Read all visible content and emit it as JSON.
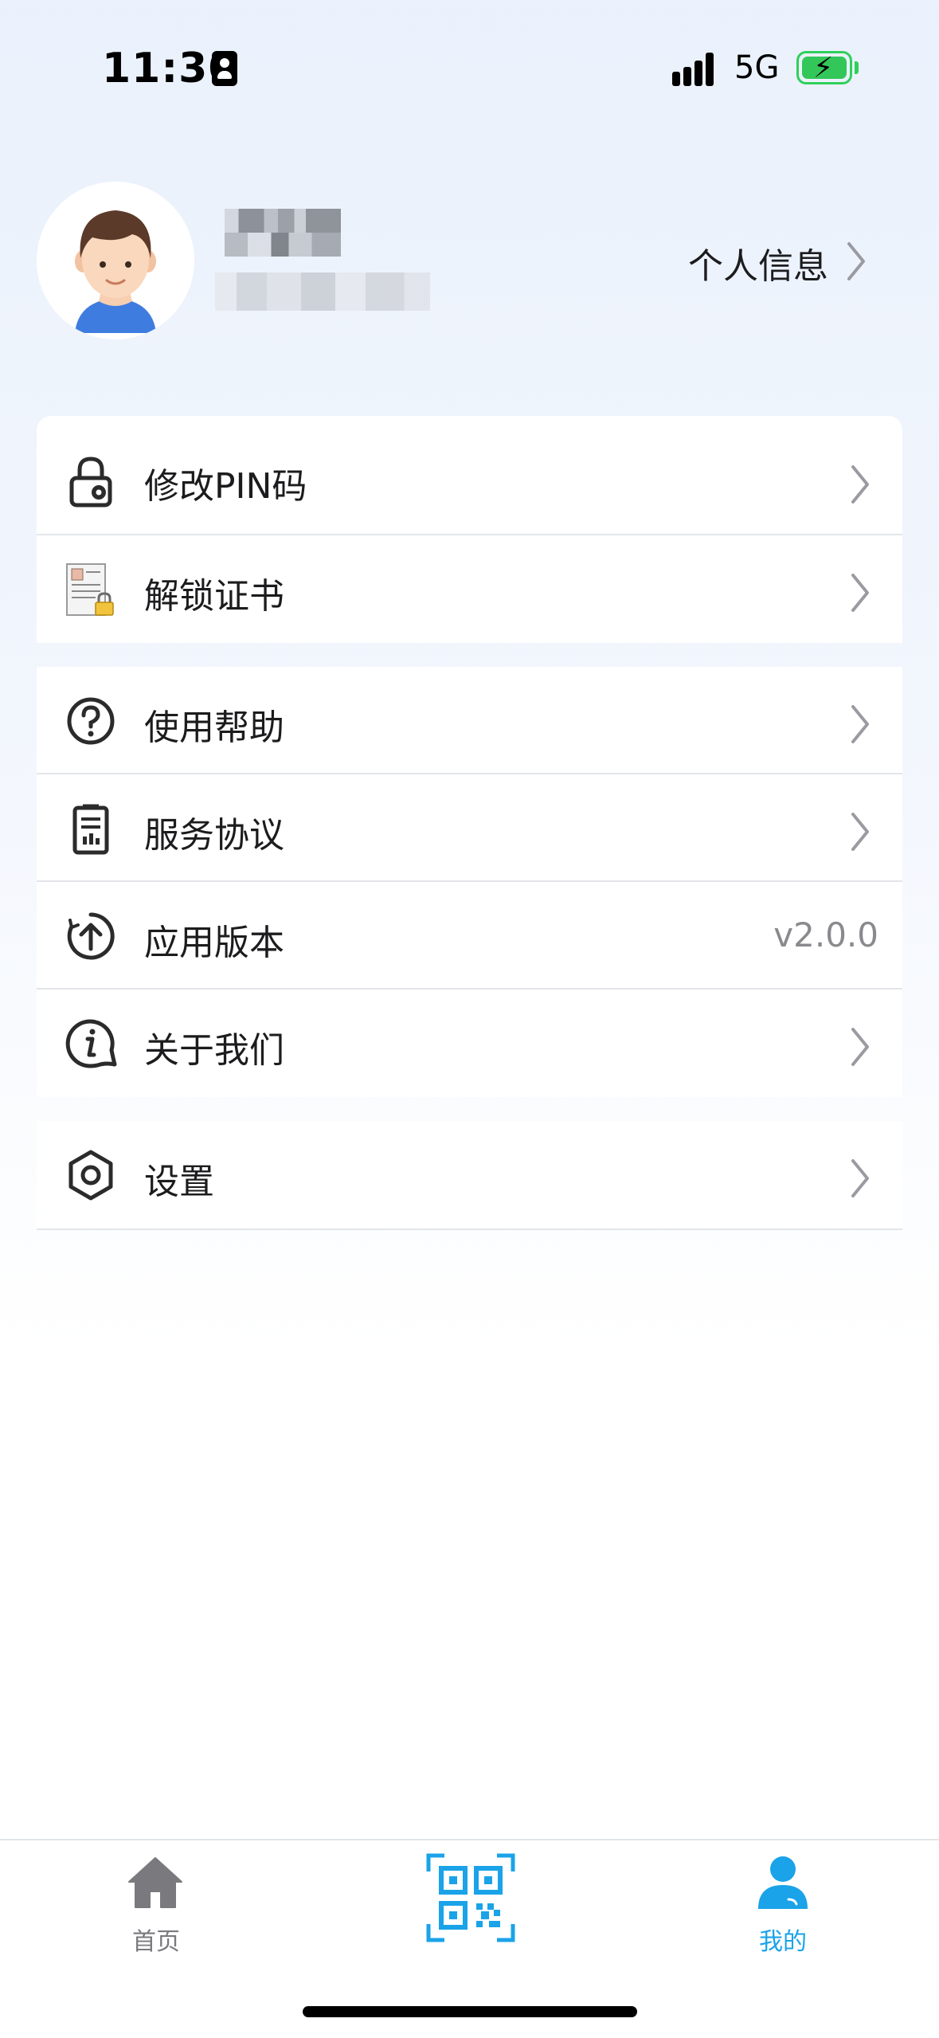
{
  "status_bar": {
    "time": "11:30",
    "network": "5G"
  },
  "profile": {
    "info_link": "个人信息"
  },
  "menu_groups": [
    [
      {
        "label": "修改PIN码",
        "icon": "lock-gear-icon"
      },
      {
        "label": "解锁证书",
        "icon": "certificate-lock-icon"
      }
    ],
    [
      {
        "label": "使用帮助",
        "icon": "question-circle-icon"
      },
      {
        "label": "服务协议",
        "icon": "clipboard-document-icon"
      },
      {
        "label": "应用版本",
        "icon": "upload-circle-icon",
        "value": "v2.0.0"
      },
      {
        "label": "关于我们",
        "icon": "info-bubble-icon"
      }
    ],
    [
      {
        "label": "设置",
        "icon": "hexagon-settings-icon"
      }
    ]
  ],
  "tabs": [
    {
      "label": "首页",
      "icon": "home-icon",
      "active": false
    },
    {
      "label": "",
      "icon": "qr-scan-icon",
      "active": false
    },
    {
      "label": "我的",
      "icon": "user-icon",
      "active": true
    }
  ],
  "colors": {
    "accent": "#1aa3e8",
    "inactive": "#7a7a7e",
    "background": "#eaf1fc"
  }
}
